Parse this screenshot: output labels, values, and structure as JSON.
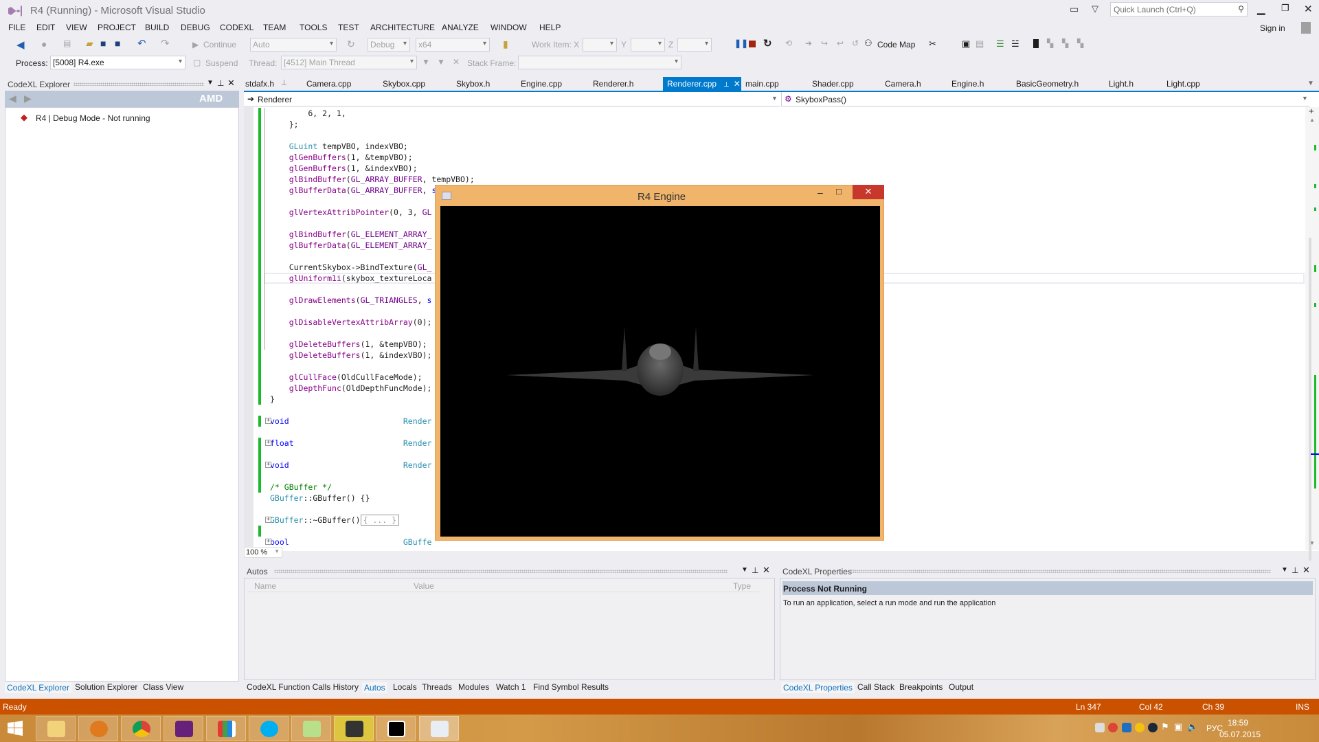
{
  "window": {
    "title": "R4 (Running) - Microsoft Visual Studio",
    "quick_launch_placeholder": "Quick Launch (Ctrl+Q)",
    "sign_in": "Sign in",
    "accent": "#007ACC"
  },
  "menu": [
    "FILE",
    "EDIT",
    "VIEW",
    "PROJECT",
    "BUILD",
    "DEBUG",
    "CODEXL",
    "TEAM",
    "TOOLS",
    "TEST",
    "ARCHITECTURE",
    "ANALYZE",
    "WINDOW",
    "HELP"
  ],
  "toolbar": {
    "continue": "Continue",
    "solution_config_combo": "Auto",
    "config_combo": "Debug",
    "platform_combo": "x64",
    "work_item_x": "Work Item: X",
    "y_label": "Y",
    "z_label": "Z",
    "code_map": "Code Map",
    "process_label": "Process:",
    "process_value": "[5008] R4.exe",
    "suspend": "Suspend",
    "thread_label": "Thread:",
    "thread_value": "[4512] Main Thread",
    "stack_frame_label": "Stack Frame:"
  },
  "left_panel": {
    "title": "CodeXL Explorer",
    "logo": "AMD",
    "tree_item": "R4 | Debug Mode - Not running",
    "tabs": [
      "CodeXL Explorer",
      "Solution Explorer",
      "Class View"
    ],
    "active_tab": 0
  },
  "doc_tabs": [
    "stdafx.h",
    "Camera.cpp",
    "Skybox.cpp",
    "Skybox.h",
    "Engine.cpp",
    "Renderer.h",
    "Renderer.cpp",
    "main.cpp",
    "Shader.cpp",
    "Camera.h",
    "Engine.h",
    "BasicGeometry.h",
    "Light.h",
    "Light.cpp"
  ],
  "active_doc_tab": 6,
  "nav": {
    "scope": "Renderer",
    "member": "SkyboxPass()"
  },
  "code": [
    {
      "line": 0,
      "t": [
        [
          "        6, 2, 1,",
          ""
        ]
      ]
    },
    {
      "line": 1,
      "t": [
        [
          "    };",
          ""
        ]
      ]
    },
    {
      "line": 3,
      "t": [
        [
          "    ",
          ""
        ],
        [
          "GLuint",
          "ty"
        ],
        [
          " tempVBO, indexVBO;",
          ""
        ]
      ]
    },
    {
      "line": 4,
      "t": [
        [
          "    ",
          ""
        ],
        [
          "glGenBuffers",
          "f"
        ],
        [
          "(1, &tempVBO);",
          ""
        ]
      ]
    },
    {
      "line": 5,
      "t": [
        [
          "    ",
          ""
        ],
        [
          "glGenBuffers",
          "f"
        ],
        [
          "(1, &indexVBO);",
          ""
        ]
      ]
    },
    {
      "line": 6,
      "t": [
        [
          "    ",
          ""
        ],
        [
          "glBindBuffer",
          "f"
        ],
        [
          "(",
          ""
        ],
        [
          "GL_ARRAY_BUFFER",
          "m"
        ],
        [
          ", tempVBO);",
          ""
        ]
      ]
    },
    {
      "line": 7,
      "t": [
        [
          "    ",
          ""
        ],
        [
          "glBufferData",
          "f"
        ],
        [
          "(",
          ""
        ],
        [
          "GL_ARRAY_BUFFER",
          "m"
        ],
        [
          ", ",
          ""
        ],
        [
          "sizeof",
          "k"
        ],
        [
          "(cube_vertices), cube_vertices, ",
          ""
        ],
        [
          "GL_STATIC_DRAW",
          "m"
        ],
        [
          ");",
          ""
        ]
      ]
    },
    {
      "line": 9,
      "t": [
        [
          "    ",
          ""
        ],
        [
          "glVertexAttribPointer",
          "f"
        ],
        [
          "(0, 3, ",
          ""
        ],
        [
          "GL",
          "m"
        ]
      ]
    },
    {
      "line": 11,
      "t": [
        [
          "    ",
          ""
        ],
        [
          "glBindBuffer",
          "f"
        ],
        [
          "(",
          ""
        ],
        [
          "GL_ELEMENT_ARRAY_",
          "m"
        ]
      ]
    },
    {
      "line": 12,
      "t": [
        [
          "    ",
          ""
        ],
        [
          "glBufferData",
          "f"
        ],
        [
          "(",
          ""
        ],
        [
          "GL_ELEMENT_ARRAY_",
          "m"
        ]
      ]
    },
    {
      "line": 14,
      "t": [
        [
          "    CurrentSkybox->BindTexture(",
          ""
        ],
        [
          "GL_",
          "m"
        ]
      ]
    },
    {
      "line": 15,
      "t": [
        [
          "    ",
          ""
        ],
        [
          "glUniform1i",
          "f"
        ],
        [
          "(skybox_textureLoca",
          ""
        ]
      ]
    },
    {
      "line": 17,
      "t": [
        [
          "    ",
          ""
        ],
        [
          "glDrawElements",
          "f"
        ],
        [
          "(",
          ""
        ],
        [
          "GL_TRIANGLES",
          "m"
        ],
        [
          ", ",
          ""
        ],
        [
          "s",
          "k"
        ]
      ]
    },
    {
      "line": 19,
      "t": [
        [
          "    ",
          ""
        ],
        [
          "glDisableVertexAttribArray",
          "f"
        ],
        [
          "(0);",
          ""
        ]
      ]
    },
    {
      "line": 21,
      "t": [
        [
          "    ",
          ""
        ],
        [
          "glDeleteBuffers",
          "f"
        ],
        [
          "(1, &tempVBO);",
          ""
        ]
      ]
    },
    {
      "line": 22,
      "t": [
        [
          "    ",
          ""
        ],
        [
          "glDeleteBuffers",
          "f"
        ],
        [
          "(1, &indexVBO);",
          ""
        ]
      ]
    },
    {
      "line": 24,
      "t": [
        [
          "    ",
          ""
        ],
        [
          "glCullFace",
          "f"
        ],
        [
          "(OldCullFaceMode);",
          ""
        ]
      ]
    },
    {
      "line": 25,
      "t": [
        [
          "    ",
          ""
        ],
        [
          "glDepthFunc",
          "f"
        ],
        [
          "(OldDepthFuncMode);",
          ""
        ]
      ]
    },
    {
      "line": 26,
      "t": [
        [
          "}",
          ""
        ]
      ]
    },
    {
      "line": 28,
      "fold": true,
      "t": [
        [
          "void",
          "k"
        ],
        [
          "                        ",
          ""
        ],
        [
          "Render",
          "ty"
        ]
      ]
    },
    {
      "line": 30,
      "fold": true,
      "t": [
        [
          "float",
          "k"
        ],
        [
          "                       ",
          ""
        ],
        [
          "Render",
          "ty"
        ]
      ]
    },
    {
      "line": 32,
      "fold": true,
      "t": [
        [
          "void",
          "k"
        ],
        [
          "                        ",
          ""
        ],
        [
          "Render",
          "ty"
        ]
      ]
    },
    {
      "line": 34,
      "t": [
        [
          "/* GBuffer */",
          "c"
        ]
      ]
    },
    {
      "line": 35,
      "t": [
        [
          "GBuffer",
          "ty"
        ],
        [
          "::GBuffer() {}",
          ""
        ]
      ]
    },
    {
      "line": 37,
      "fold": true,
      "t": [
        [
          "GBuffer",
          "ty"
        ],
        [
          "::~GBuffer()",
          ""
        ],
        [
          "{ ... }",
          "c"
        ]
      ]
    },
    {
      "line": 39,
      "fold": true,
      "t": [
        [
          "bool",
          "k"
        ],
        [
          "                        ",
          ""
        ],
        [
          "GBuffe",
          "ty"
        ]
      ]
    }
  ],
  "zoom_level": "100 %",
  "engine_window": {
    "title": "R4 Engine"
  },
  "autos": {
    "title": "Autos",
    "columns": [
      "Name",
      "Value",
      "Type"
    ]
  },
  "bottom_tabs": [
    "CodeXL Function Calls History",
    "Autos",
    "Locals",
    "Threads",
    "Modules",
    "Watch 1",
    "Find Symbol Results"
  ],
  "bottom_active_tab": 1,
  "properties": {
    "title": "CodeXL Properties",
    "heading": "Process Not Running",
    "message": "To run an application, select a run mode and run the application",
    "tabs": [
      "CodeXL Properties",
      "Call Stack",
      "Breakpoints",
      "Output"
    ],
    "active_tab": 0
  },
  "status": {
    "text": "Ready",
    "ln": "Ln 347",
    "col": "Col 42",
    "ch": "Ch 39",
    "mode": "INS",
    "color": "#CA5100"
  },
  "taskbar": {
    "apps": [
      "file-explorer",
      "media-player",
      "chrome",
      "visual-studio",
      "apps",
      "skype",
      "notepad-plus-plus",
      "media-player-classic",
      "codexl",
      "window"
    ],
    "tray": [
      "dropbox",
      "chrome",
      "network-app",
      "badge-4",
      "steam",
      "flag",
      "network",
      "volume"
    ],
    "language": "РУС",
    "time": "18:59",
    "date": "05.07.2015"
  }
}
